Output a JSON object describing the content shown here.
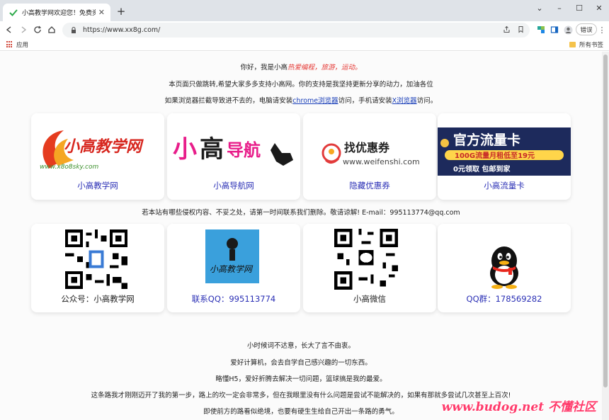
{
  "browser": {
    "tab_title": "小高教学网欢迎您！免费资源分享",
    "tab_close": "✕",
    "new_tab": "+",
    "win_minimize": "–",
    "win_maximize": "☐",
    "win_close": "✕",
    "chevron": "⌄",
    "url": "https://www.xx8g.com/",
    "error_button": "错误",
    "bookmarks_apps": "应用",
    "bookmarks_all": "所有书签",
    "accent": "#1a73e8"
  },
  "intro": {
    "line1_prefix": "你好，我是小高",
    "line1_highlight": "热爱编程，旅游，运动。",
    "line2": "本页面只做跳转,希望大家多多支持小高网。你的支持是我坚持更新分享的动力，加油各位",
    "line3_a": "如果浏览器拦截导致进不去的，电脑请安装",
    "line3_link1": "chrome浏览器",
    "line3_b": "访问，手机请安装",
    "line3_link2": "X浏览器",
    "line3_c": "访问。"
  },
  "cards_row1": [
    {
      "label": "小高教学网",
      "logo_text": "小高教学网",
      "logo_sub": "www.x8o8sky.com"
    },
    {
      "label": "小高导航网",
      "logo_text_a": "小",
      "logo_text_b": "高",
      "logo_text_c": "导航"
    },
    {
      "label": "隐藏优惠券",
      "logo_text": "找优惠券",
      "logo_sub": "www.weifenshi.com"
    },
    {
      "label": "小高流量卡",
      "logo_title": "官方流量卡",
      "logo_line2": "100G流量月租低至19元",
      "logo_line3": "0元领取 包邮到家"
    }
  ],
  "notice": "若本站有哪些侵权内容、不妥之处，请第一时间联系我们删除。敬请谅解! E-mail：995113774@qq.com",
  "cards_row2": [
    {
      "label": "公众号：小高教学网"
    },
    {
      "label": "联系QQ：995113774",
      "logo_text": "小高教学网"
    },
    {
      "label": "小高微信"
    },
    {
      "label": "QQ群：178569282"
    }
  ],
  "outro": [
    "小时候词不达意，长大了言不由衷。",
    "爱好计算机，会去自学自己感兴趣的一切东西。",
    "略懂H5，爱好折腾去解决一切问题，篮球搞是我的最爱。",
    "这条路我才刚刚迈开了我的第一步，路上的坎一定会非常多，但在我眼里没有什么问题是尝试不能解决的，如果有那就多尝试几次甚至上百次!",
    "即使前方的路看似绝境，也要有硬生生给自己开出一条路的勇气。"
  ],
  "watermark": "www.budog.net 不懂社区"
}
